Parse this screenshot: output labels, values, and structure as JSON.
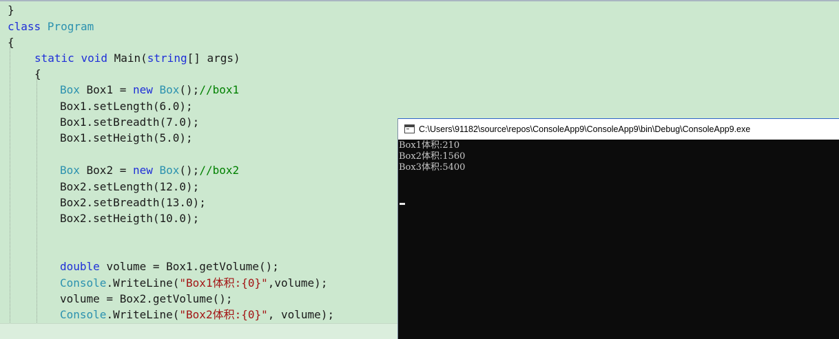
{
  "editor": {
    "lines": [
      [
        {
          "t": "}",
          "c": "pl"
        }
      ],
      [
        {
          "t": "class ",
          "c": "kw"
        },
        {
          "t": "Program",
          "c": "ty"
        }
      ],
      [
        {
          "t": "{",
          "c": "pl"
        }
      ],
      [
        {
          "t": "static ",
          "c": "kw"
        },
        {
          "t": "void ",
          "c": "kw"
        },
        {
          "t": "Main(",
          "c": "pl"
        },
        {
          "t": "string",
          "c": "kw"
        },
        {
          "t": "[] args)",
          "c": "pl"
        }
      ],
      [
        {
          "t": "{",
          "c": "pl"
        }
      ],
      [
        {
          "t": "Box",
          "c": "ty"
        },
        {
          "t": " Box1 = ",
          "c": "pl"
        },
        {
          "t": "new ",
          "c": "kw"
        },
        {
          "t": "Box",
          "c": "ty"
        },
        {
          "t": "();",
          "c": "pl"
        },
        {
          "t": "//box1",
          "c": "cm"
        }
      ],
      [
        {
          "t": "Box1.setLength(6.0);",
          "c": "pl"
        }
      ],
      [
        {
          "t": "Box1.setBreadth(7.0);",
          "c": "pl"
        }
      ],
      [
        {
          "t": "Box1.setHeigth(5.0);",
          "c": "pl"
        }
      ],
      [],
      [
        {
          "t": "Box",
          "c": "ty"
        },
        {
          "t": " Box2 = ",
          "c": "pl"
        },
        {
          "t": "new ",
          "c": "kw"
        },
        {
          "t": "Box",
          "c": "ty"
        },
        {
          "t": "();",
          "c": "pl"
        },
        {
          "t": "//box2",
          "c": "cm"
        }
      ],
      [
        {
          "t": "Box2.setLength(12.0);",
          "c": "pl"
        }
      ],
      [
        {
          "t": "Box2.setBreadth(13.0);",
          "c": "pl"
        }
      ],
      [
        {
          "t": "Box2.setHeigth(10.0);",
          "c": "pl"
        }
      ],
      [],
      [],
      [
        {
          "t": "double ",
          "c": "kw"
        },
        {
          "t": "volume = Box1.getVolume();",
          "c": "pl"
        }
      ],
      [
        {
          "t": "Console",
          "c": "ty"
        },
        {
          "t": ".WriteLine(",
          "c": "pl"
        },
        {
          "t": "\"Box1体积:{0}\"",
          "c": "st"
        },
        {
          "t": ",volume);",
          "c": "pl"
        }
      ],
      [
        {
          "t": "volume = Box2.getVolume();",
          "c": "pl"
        }
      ],
      [
        {
          "t": "Console",
          "c": "ty"
        },
        {
          "t": ".WriteLine(",
          "c": "pl"
        },
        {
          "t": "\"Box2体积:{0}\"",
          "c": "st"
        },
        {
          "t": ", volume);",
          "c": "pl"
        }
      ]
    ]
  },
  "console": {
    "title": "C:\\Users\\91182\\source\\repos\\ConsoleApp9\\ConsoleApp9\\bin\\Debug\\ConsoleApp9.exe",
    "output": [
      "Box1体积:210",
      "Box2体积:1560",
      "Box3体积:5400"
    ]
  }
}
